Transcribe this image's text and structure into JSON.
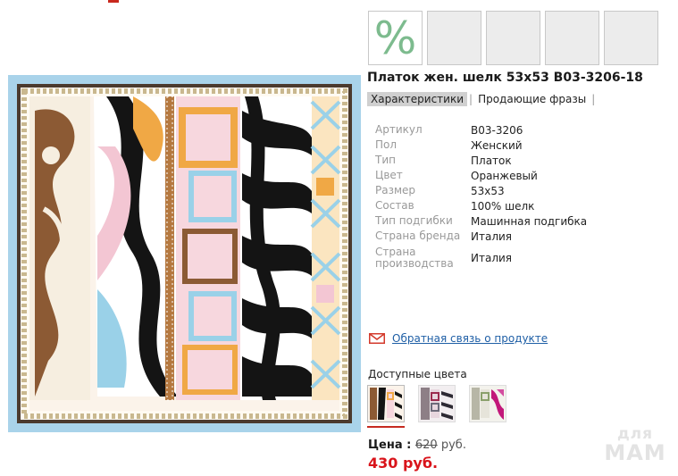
{
  "thumbnails": {
    "active_glyph": "%",
    "count": 5
  },
  "product": {
    "title": "Платок жен. шелк 53x53 B03-3206-18"
  },
  "tabs": [
    {
      "label": "Характеристики",
      "active": true
    },
    {
      "label": "Продающие фразы",
      "active": false
    }
  ],
  "specs": [
    {
      "key": "Артикул",
      "value": "B03-3206"
    },
    {
      "key": "Пол",
      "value": "Женский"
    },
    {
      "key": "Тип",
      "value": "Платок"
    },
    {
      "key": "Цвет",
      "value": "Оранжевый"
    },
    {
      "key": "Размер",
      "value": "53x53"
    },
    {
      "key": "Состав",
      "value": "100% шелк"
    },
    {
      "key": "Тип подгибки",
      "value": "Машинная подгибка"
    },
    {
      "key": "Страна бренда",
      "value": "Италия"
    },
    {
      "key": "Страна производства",
      "value": "Италия"
    }
  ],
  "feedback": {
    "icon": "envelope-icon",
    "label": "Обратная связь о продукте"
  },
  "colors": {
    "label": "Доступные цвета"
  },
  "price": {
    "label": "Цена :",
    "old_value": "620",
    "old_unit": "руб.",
    "new": "430 руб."
  },
  "watermark": {
    "line1": "для",
    "line2": "МАМ"
  },
  "palette": {
    "accent_red": "#d9141b",
    "link_blue": "#1f5fa6",
    "percent_green": "#7dbb8e"
  }
}
